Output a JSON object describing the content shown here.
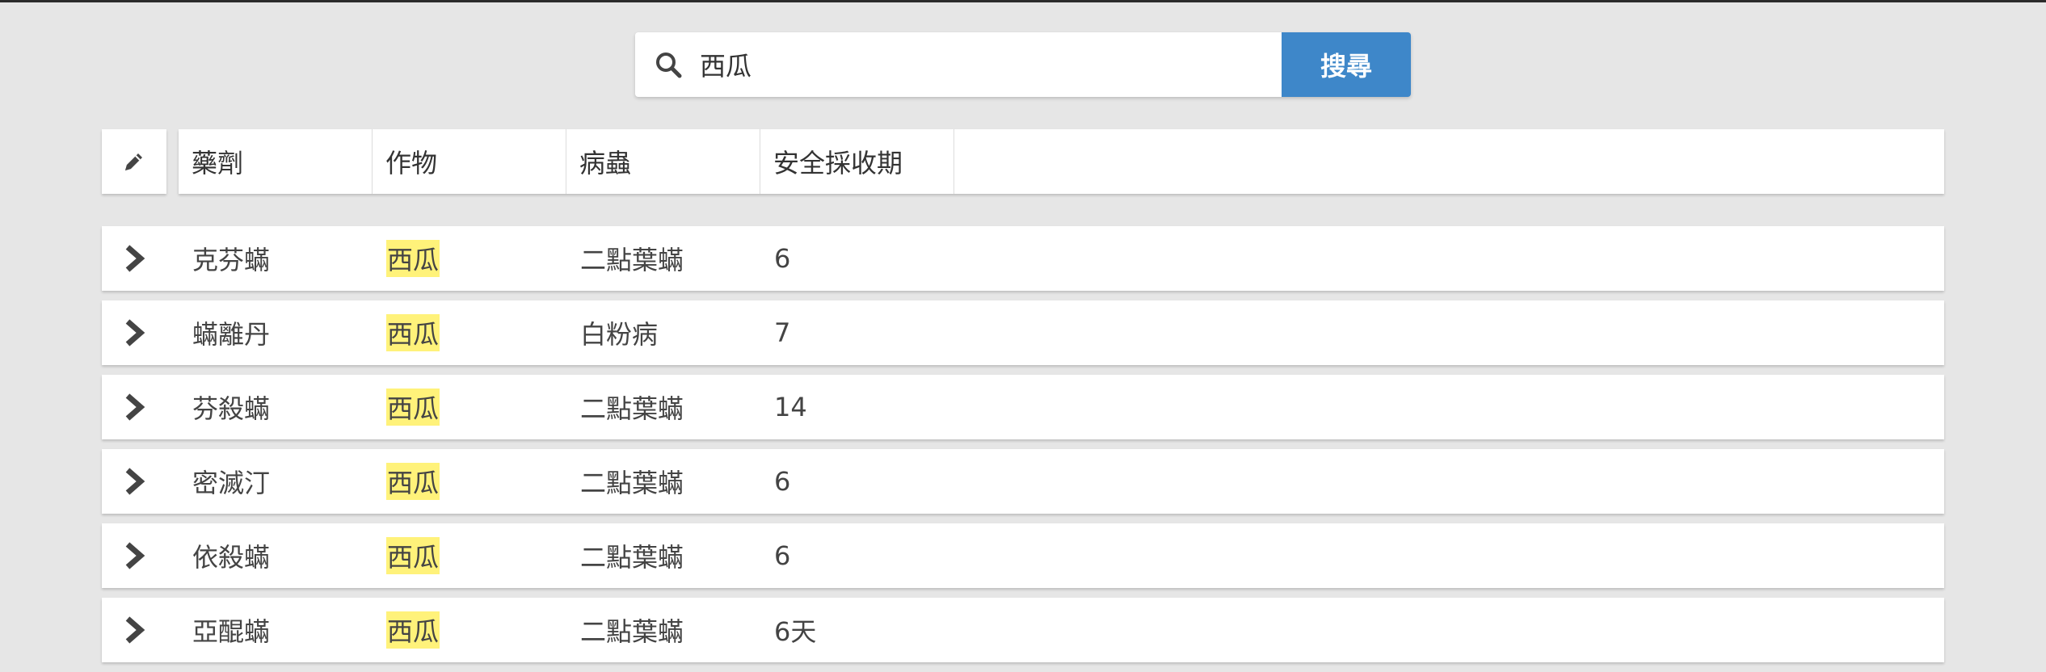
{
  "search": {
    "value": "西瓜",
    "button_label": "搜尋"
  },
  "table": {
    "columns": [
      "藥劑",
      "作物",
      "病蟲",
      "安全採收期"
    ],
    "rows": [
      {
        "drug": "克芬蟎",
        "crop": "西瓜",
        "pest": "二點葉蟎",
        "safe_period": "6"
      },
      {
        "drug": "蟎離丹",
        "crop": "西瓜",
        "pest": "白粉病",
        "safe_period": "7"
      },
      {
        "drug": "芬殺蟎",
        "crop": "西瓜",
        "pest": "二點葉蟎",
        "safe_period": "14"
      },
      {
        "drug": "密滅汀",
        "crop": "西瓜",
        "pest": "二點葉蟎",
        "safe_period": "6"
      },
      {
        "drug": "依殺蟎",
        "crop": "西瓜",
        "pest": "二點葉蟎",
        "safe_period": "6"
      },
      {
        "drug": "亞醌蟎",
        "crop": "西瓜",
        "pest": "二點葉蟎",
        "safe_period": "6天"
      }
    ]
  },
  "colors": {
    "background": "#e6e6e6",
    "search_button": "#3e87c9",
    "highlight": "#fff27a"
  },
  "icons": {
    "search": "search-icon",
    "edit": "pencil-icon",
    "expand": "chevron-right-icon"
  }
}
